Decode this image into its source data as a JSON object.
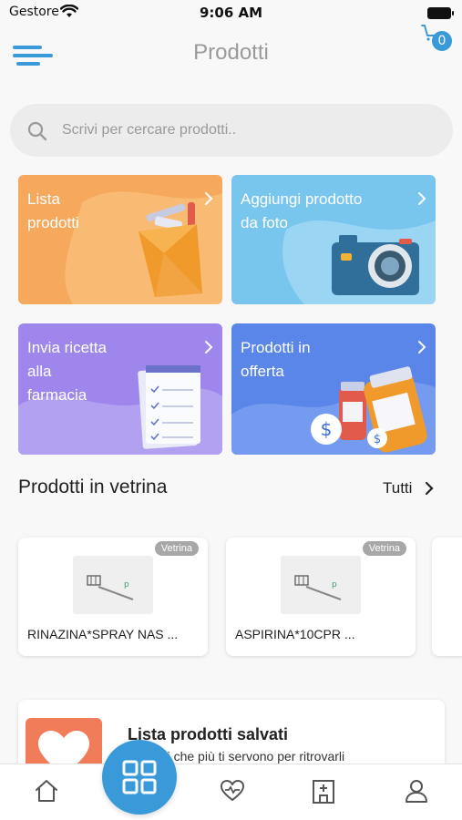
{
  "status_bar": {
    "carrier": "Gestore",
    "time": "9:06 AM"
  },
  "header": {
    "title": "Prodotti",
    "cart_count": "0"
  },
  "search": {
    "placeholder": "Scrivi per cercare prodotti.."
  },
  "colors": {
    "accent": "#3a9ad9",
    "card_orange": "#f6a95c",
    "card_lightblue": "#78c6ee",
    "card_purple": "#9f86ec",
    "card_blue": "#5a86ea"
  },
  "cards": [
    {
      "label": "Lista\nprodotti",
      "icon": "shopping-bag-icon"
    },
    {
      "label": "Aggiungi prodotto\nda foto",
      "icon": "camera-icon"
    },
    {
      "label": "Invia ricetta\nalla\nfarmacia",
      "icon": "checklist-icon"
    },
    {
      "label": "Prodotti in\nofferta",
      "icon": "offer-jars-icon"
    }
  ],
  "showcase": {
    "title": "Prodotti in vetrina",
    "all_label": "Tutti",
    "products": [
      {
        "badge": "Vetrina",
        "name": "RINAZINA*SPRAY NAS ..."
      },
      {
        "badge": "Vetrina",
        "name": "ASPIRINA*10CPR ..."
      }
    ]
  },
  "saved_list": {
    "title": "Lista prodotti salvati",
    "subtitle": "prodotti che più ti servono per ritrovarli"
  },
  "tabs": [
    {
      "icon": "home-icon"
    },
    {
      "icon": "grid-icon"
    },
    {
      "icon": "heart-pulse-icon"
    },
    {
      "icon": "pharmacy-icon"
    },
    {
      "icon": "user-icon"
    }
  ]
}
